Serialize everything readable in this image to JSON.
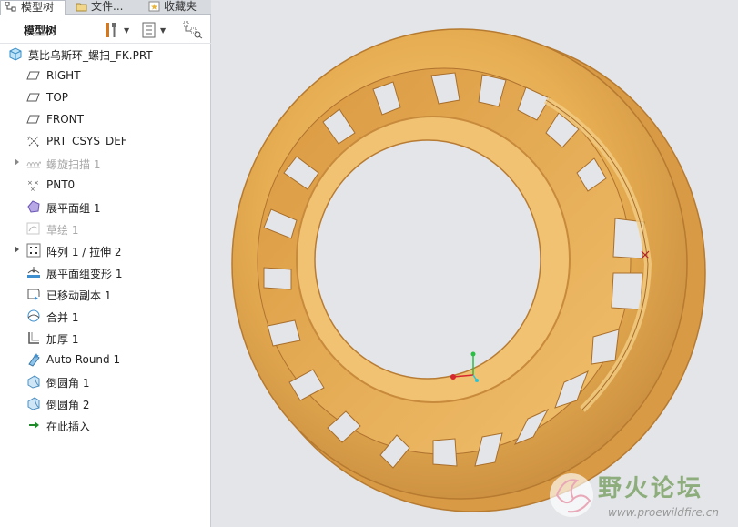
{
  "tabs": [
    {
      "label": "模型树",
      "icon": "model-tree-icon"
    },
    {
      "label": "文件...",
      "icon": "folder-icon"
    },
    {
      "label": "收藏夹",
      "icon": "favorites-icon"
    }
  ],
  "toolbar": {
    "title": "模型树",
    "settings_icon": "tree-settings-icon",
    "columns_icon": "tree-columns-icon",
    "filter_icon": "tree-filter-icon"
  },
  "tree": {
    "root": {
      "label": "莫比乌斯环_螺扫_FK.PRT",
      "icon": "part-icon"
    },
    "items": [
      {
        "label": "RIGHT",
        "icon": "datum-plane-icon",
        "dim": false,
        "expandable": false
      },
      {
        "label": "TOP",
        "icon": "datum-plane-icon",
        "dim": false,
        "expandable": false
      },
      {
        "label": "FRONT",
        "icon": "datum-plane-icon",
        "dim": false,
        "expandable": false
      },
      {
        "label": "PRT_CSYS_DEF",
        "icon": "coordinate-system-icon",
        "dim": false,
        "expandable": false
      },
      {
        "label": "螺旋扫描 1",
        "icon": "helical-sweep-icon",
        "dim": true,
        "expandable": true
      },
      {
        "label": "PNT0",
        "icon": "datum-point-icon",
        "dim": false,
        "expandable": false
      },
      {
        "label": "展平面组 1",
        "icon": "flatten-quilt-icon",
        "dim": false,
        "expandable": false
      },
      {
        "label": "草绘 1",
        "icon": "sketch-icon",
        "dim": true,
        "expandable": false
      },
      {
        "label": "阵列 1 / 拉伸 2",
        "icon": "pattern-icon",
        "dim": false,
        "expandable": true
      },
      {
        "label": "展平面组变形 1",
        "icon": "flatten-deform-icon",
        "dim": false,
        "expandable": false
      },
      {
        "label": "已移动副本 1",
        "icon": "moved-copy-icon",
        "dim": false,
        "expandable": false
      },
      {
        "label": "合并 1",
        "icon": "merge-icon",
        "dim": false,
        "expandable": false
      },
      {
        "label": "加厚 1",
        "icon": "thicken-icon",
        "dim": false,
        "expandable": false
      },
      {
        "label": "Auto Round 1",
        "icon": "auto-round-icon",
        "dim": false,
        "expandable": false
      },
      {
        "label": "倒圆角 1",
        "icon": "round-icon",
        "dim": false,
        "expandable": false
      },
      {
        "label": "倒圆角 2",
        "icon": "round-icon",
        "dim": false,
        "expandable": false
      },
      {
        "label": "在此插入",
        "icon": "insert-here-arrow-icon",
        "dim": false,
        "expandable": false
      }
    ]
  },
  "viewport": {
    "model": "mobius-ring-model",
    "model_color": "#e7ad52",
    "background": "#e3e5e8"
  },
  "watermark": {
    "title": "野火论坛",
    "url": "www.proewildfire.cn"
  }
}
